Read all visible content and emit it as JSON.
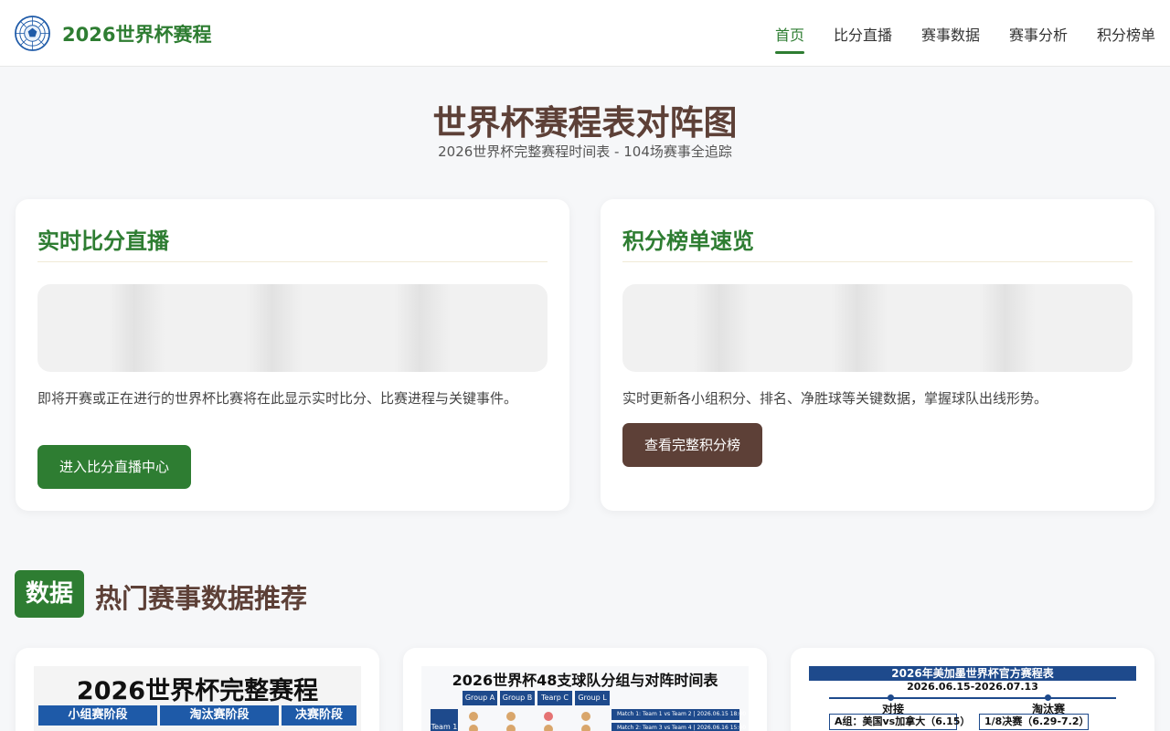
{
  "header": {
    "brand": "2026世界杯赛程",
    "logo_icon": "soccer-ball-icon",
    "nav": [
      {
        "label": "首页",
        "active": true
      },
      {
        "label": "比分直播",
        "active": false
      },
      {
        "label": "赛事数据",
        "active": false
      },
      {
        "label": "赛事分析",
        "active": false
      },
      {
        "label": "积分榜单",
        "active": false
      }
    ]
  },
  "hero": {
    "title": "世界杯赛程表对阵图",
    "subtitle": "2026世界杯完整赛程时间表 - 104场赛事全追踪"
  },
  "cards": [
    {
      "title": "实时比分直播",
      "description": "即将开赛或正在进行的世界杯比赛将在此显示实时比分、比赛进程与关键事件。",
      "button": "进入比分直播中心"
    },
    {
      "title": "积分榜单速览",
      "description": "实时更新各小组积分、排名、净胜球等关键数据，掌握球队出线形势。",
      "button": "查看完整积分榜"
    }
  ],
  "section": {
    "badge": "数据",
    "title": "热门赛事数据推荐"
  },
  "thumbs": [
    {
      "title": "2026世界杯完整赛程",
      "tabs": [
        "小组赛阶段",
        "淘汰赛阶段",
        "决赛阶段"
      ]
    },
    {
      "title": "2026世界杯48支球队分组与对阵时间表",
      "groups": [
        "Group A",
        "Group B",
        "Tearp C",
        "Group L"
      ],
      "team_label": "Team 1",
      "matches": [
        "Match 1: Team 1 vs Team 2 | 2026.06.15 18:00",
        "Match 2: Team 3 vs Team 4 | 2026.06.16 15:00"
      ]
    },
    {
      "title": "2026年美加墨世界杯官方赛程表",
      "dates": "2026.06.15-2026.07.13",
      "labels": [
        "对接",
        "淘汰赛"
      ],
      "boxes": [
        "A组：美国vs加拿大（6.15）",
        "1/8决赛（6.29-7.2）"
      ]
    }
  ],
  "colors": {
    "primary_green": "#2e7d32",
    "brown": "#5d4037",
    "navy": "#1e4a8c",
    "background": "#f6f7f9"
  }
}
